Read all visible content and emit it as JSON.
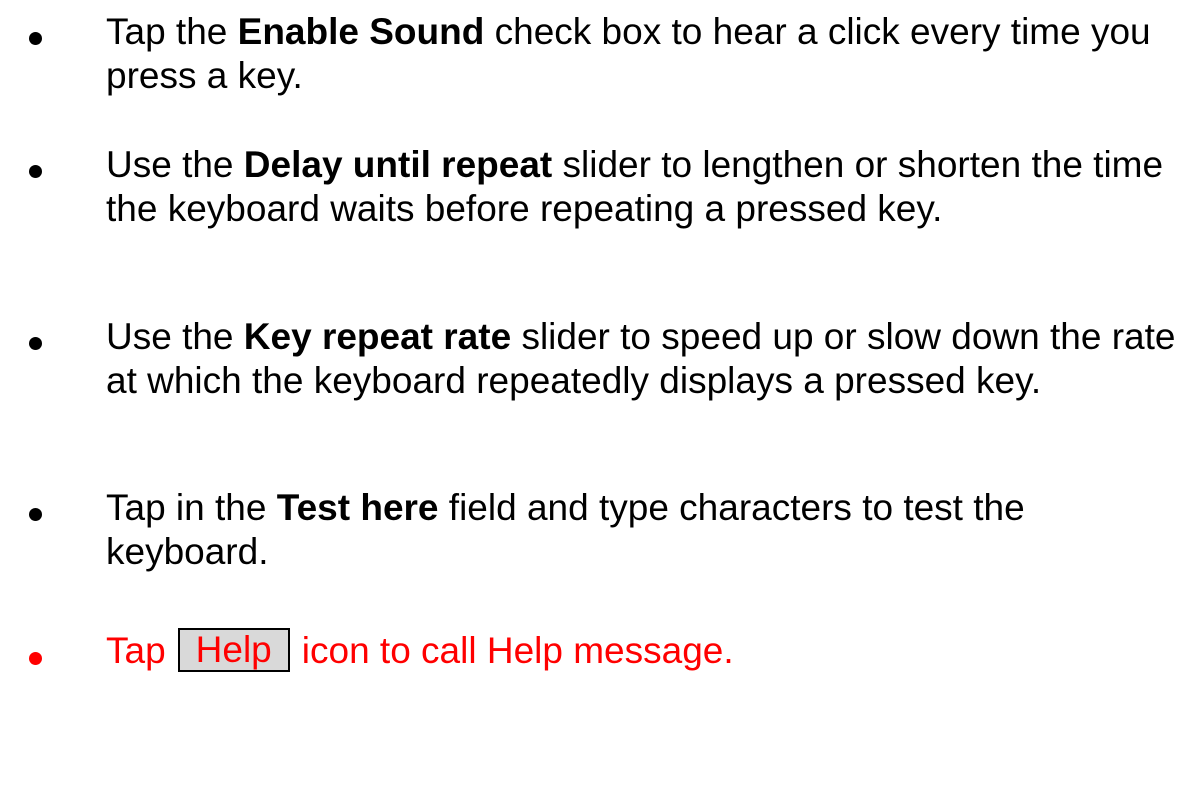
{
  "items": [
    {
      "pre": "Tap the ",
      "bold": "Enable Sound",
      "post": " check box to hear a click every time you press a key."
    },
    {
      "pre": "Use the ",
      "bold": "Delay until repeat",
      "post": " slider to lengthen or shorten the time the keyboard waits before repeating a pressed key."
    },
    {
      "pre": "Use the ",
      "bold": "Key repeat rate",
      "post": " slider to speed up or slow down the rate at which the keyboard repeatedly displays a pressed key."
    },
    {
      "pre": "Tap in the ",
      "bold": "Test here",
      "post": " field and type characters to test the keyboard."
    }
  ],
  "help_item": {
    "pre": "Tap",
    "button_label": "Help",
    "post": "icon to call Help message."
  },
  "colors": {
    "text": "#000000",
    "highlight": "#ff0000",
    "help_button_bg": "#d9d9d9"
  }
}
